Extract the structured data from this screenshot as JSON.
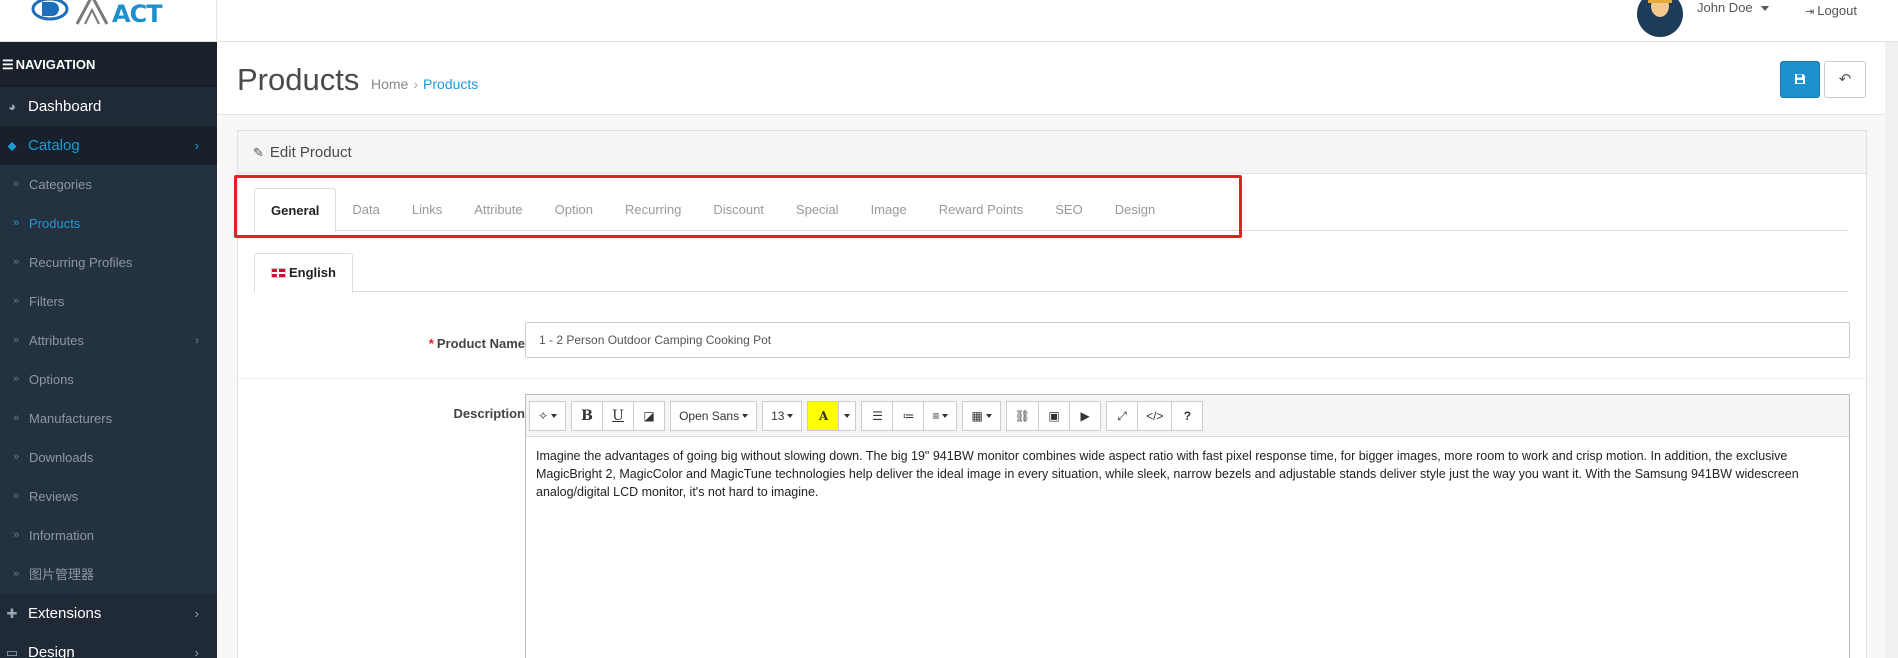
{
  "header": {
    "logo_text": "ACT",
    "user_name": "John Doe",
    "logout_label": "Logout"
  },
  "sidebar": {
    "heading": "NAVIGATION",
    "items": [
      {
        "label": "Dashboard",
        "icon": "dashboard-icon"
      },
      {
        "label": "Catalog",
        "icon": "tags-icon",
        "active": true
      },
      {
        "label": "Extensions",
        "icon": "puzzle-icon"
      },
      {
        "label": "Design",
        "icon": "monitor-icon"
      }
    ],
    "catalog_sub": [
      {
        "label": "Categories"
      },
      {
        "label": "Products",
        "active": true
      },
      {
        "label": "Recurring Profiles"
      },
      {
        "label": "Filters"
      },
      {
        "label": "Attributes",
        "has_children": true
      },
      {
        "label": "Options"
      },
      {
        "label": "Manufacturers"
      },
      {
        "label": "Downloads"
      },
      {
        "label": "Reviews"
      },
      {
        "label": "Information"
      },
      {
        "label": "图片管理器"
      }
    ]
  },
  "page": {
    "title": "Products",
    "breadcrumb": [
      "Home",
      "Products"
    ],
    "save_icon": "save-icon",
    "back_icon": "reply-icon"
  },
  "panel": {
    "heading": "Edit Product",
    "tabs": [
      "General",
      "Data",
      "Links",
      "Attribute",
      "Option",
      "Recurring",
      "Discount",
      "Special",
      "Image",
      "Reward Points",
      "SEO",
      "Design"
    ],
    "active_tab": "General",
    "language_tab": "English",
    "form": {
      "product_name_label": "Product Name",
      "product_name_value": "1 - 2 Person Outdoor Camping Cooking Pot",
      "description_label": "Description",
      "description_text": "Imagine the advantages of going big without slowing down. The big 19\" 941BW monitor combines wide aspect ratio with fast pixel response time, for bigger images, more room to work and crisp motion. In addition, the exclusive MagicBright 2, MagicColor and MagicTune technologies help deliver the ideal image in every situation, while sleek, narrow bezels and adjustable stands deliver style just the way you want it. With the Samsung 941BW widescreen analog/digital LCD monitor, it's not hard to imagine."
    },
    "editor_toolbar": {
      "font_family": "Open Sans",
      "font_size": "13",
      "color_letter": "A",
      "help": "?",
      "bold": "B",
      "underline": "U"
    }
  },
  "colors": {
    "accent": "#1e91cf",
    "sidebar_bg": "#1f2a36",
    "highlight": "#e51f24"
  }
}
